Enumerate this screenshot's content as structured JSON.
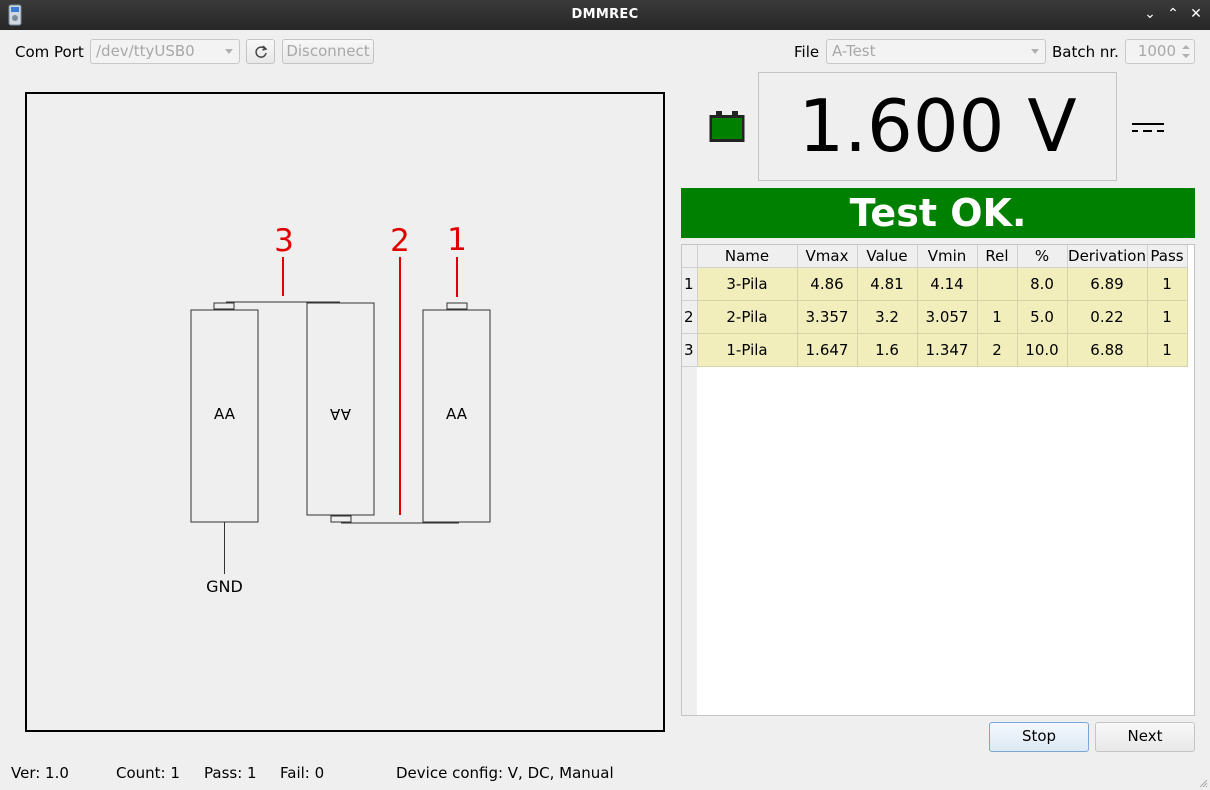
{
  "window": {
    "title": "DMMREC"
  },
  "toolbar": {
    "com_port_label": "Com Port",
    "com_port_value": "/dev/ttyUSB0",
    "disconnect_label": "Disconnect",
    "file_label": "File",
    "file_value": "A-Test",
    "batch_label": "Batch nr.",
    "batch_value": "1000"
  },
  "diagram": {
    "battery_labels": [
      "AA",
      "AA",
      "AA"
    ],
    "probe_labels": [
      "3",
      "2",
      "1"
    ],
    "ground_label": "GND"
  },
  "display": {
    "reading": "1.600 V",
    "battery_color": "#008000",
    "mode_icon": "dc-symbol-icon"
  },
  "result": {
    "text": "Test OK.",
    "color": "#008000"
  },
  "table": {
    "columns": [
      "Name",
      "Vmax",
      "Value",
      "Vmin",
      "Rel",
      "%",
      "Derivation",
      "Pass"
    ],
    "rows": [
      {
        "index": "1",
        "cells": [
          "3-Pila",
          "4.86",
          "4.81",
          "4.14",
          "",
          "8.0",
          "6.89",
          "1"
        ]
      },
      {
        "index": "2",
        "cells": [
          "2-Pila",
          "3.357",
          "3.2",
          "3.057",
          "1",
          "5.0",
          "0.22",
          "1"
        ]
      },
      {
        "index": "3",
        "cells": [
          "1-Pila",
          "1.647",
          "1.6",
          "1.347",
          "2",
          "10.0",
          "6.88",
          "1"
        ]
      }
    ],
    "row_color": "#f1eebc"
  },
  "buttons": {
    "stop": "Stop",
    "next": "Next"
  },
  "status_bar": {
    "version": "Ver: 1.0",
    "count": "Count: 1",
    "pass": "Pass: 1",
    "fail": "Fail: 0",
    "device_config": "Device config: V, DC, Manual"
  }
}
